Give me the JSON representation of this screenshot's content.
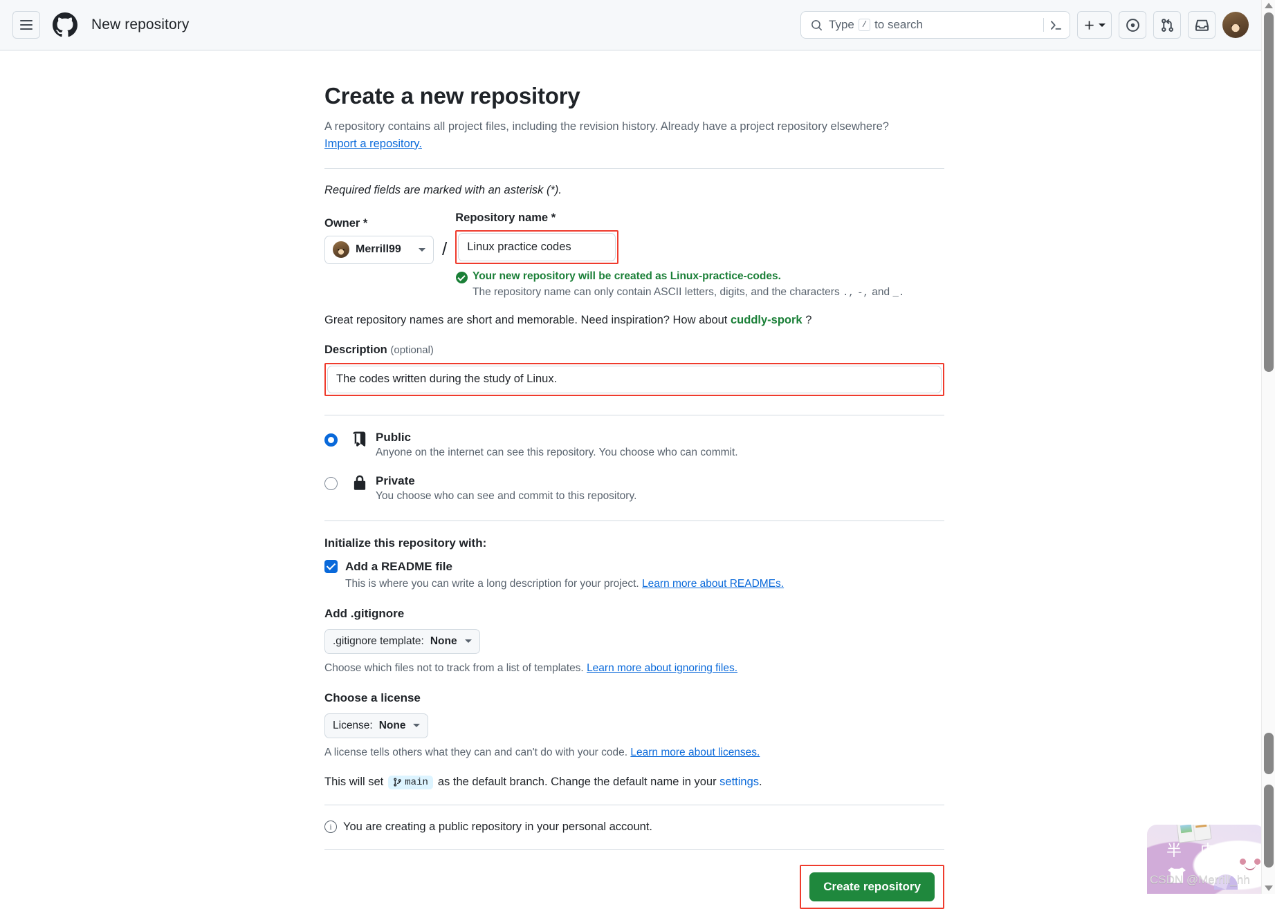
{
  "topbar": {
    "menu_icon": "hamburger-menu-icon",
    "logo_icon": "github-logo-icon",
    "title": "New repository",
    "search": {
      "icon": "search-icon",
      "placeholder_prefix": "Type",
      "slash_key": "/",
      "placeholder_suffix": "to search",
      "terminal_icon": "command-palette-icon"
    },
    "create_new_icon": "plus-icon",
    "create_new_caret_icon": "chevron-down-icon",
    "issues_icon": "issues-dot-icon",
    "pull_requests_icon": "pull-request-icon",
    "inbox_icon": "inbox-icon",
    "avatar_icon": "user-avatar"
  },
  "page": {
    "heading": "Create a new repository",
    "description": "A repository contains all project files, including the revision history. Already have a project repository elsewhere?",
    "import_link": "Import a repository.",
    "required_note": "Required fields are marked with an asterisk (*)."
  },
  "owner": {
    "label": "Owner *",
    "name": "Merrill99",
    "avatar_icon": "owner-avatar",
    "caret_icon": "chevron-down-icon",
    "separator": "/"
  },
  "repo_name": {
    "label": "Repository name *",
    "value": "Linux practice codes",
    "validation_icon": "check-circle-icon",
    "validation_text": "Your new repository will be created as Linux-practice-codes.",
    "hint_prefix": "The repository name can only contain ASCII letters, digits, and the characters",
    "hint_chars_1": ".,",
    "hint_chars_2": "-,",
    "hint_and": "and",
    "hint_chars_3": "_."
  },
  "suggestion": {
    "prefix": "Great repository names are short and memorable. Need inspiration? How about",
    "name": "cuddly-spork",
    "suffix": "?"
  },
  "description_field": {
    "label": "Description",
    "optional": "(optional)",
    "value": "The codes written during the study of Linux.",
    "placeholder": ""
  },
  "visibility": {
    "options": [
      {
        "id": "public",
        "title": "Public",
        "subtitle": "Anyone on the internet can see this repository. You choose who can commit.",
        "icon": "repo-book-icon",
        "selected": true
      },
      {
        "id": "private",
        "title": "Private",
        "subtitle": "You choose who can see and commit to this repository.",
        "icon": "lock-icon",
        "selected": false
      }
    ]
  },
  "initialize": {
    "title": "Initialize this repository with:",
    "readme_label": "Add a README file",
    "readme_checked": true,
    "readme_sub_prefix": "This is where you can write a long description for your project.",
    "readme_link": "Learn more about READMEs."
  },
  "gitignore": {
    "title": "Add .gitignore",
    "button_prefix": ".gitignore template:",
    "button_value": "None",
    "caret_icon": "chevron-down-icon",
    "sub_prefix": "Choose which files not to track from a list of templates.",
    "sub_link": "Learn more about ignoring files."
  },
  "license": {
    "title": "Choose a license",
    "button_prefix": "License:",
    "button_value": "None",
    "caret_icon": "chevron-down-icon",
    "sub_prefix": "A license tells others what they can and can't do with your code.",
    "sub_link": "Learn more about licenses."
  },
  "branch": {
    "prefix": "This will set",
    "chip_icon": "git-branch-icon",
    "chip_label": "main",
    "middle": "as the default branch. Change the default name in your",
    "link": "settings",
    "suffix": "."
  },
  "notice": {
    "icon": "info-icon",
    "text": "You are creating a public repository in your personal account."
  },
  "submit": {
    "label": "Create repository"
  },
  "watermark": {
    "cn_text": "半 中",
    "credit": "CSDN @Merrill_hh"
  },
  "scrollbar": {
    "up_arrow_icon": "scroll-up-arrow-icon",
    "down_arrow_icon": "scroll-down-arrow-icon"
  },
  "colors": {
    "accent_blue": "#0969da",
    "success_green": "#1a7f37",
    "button_green": "#1f883d",
    "highlight_red": "#ef3b2d",
    "border": "#d1d9e0",
    "muted_text": "#59636e"
  }
}
